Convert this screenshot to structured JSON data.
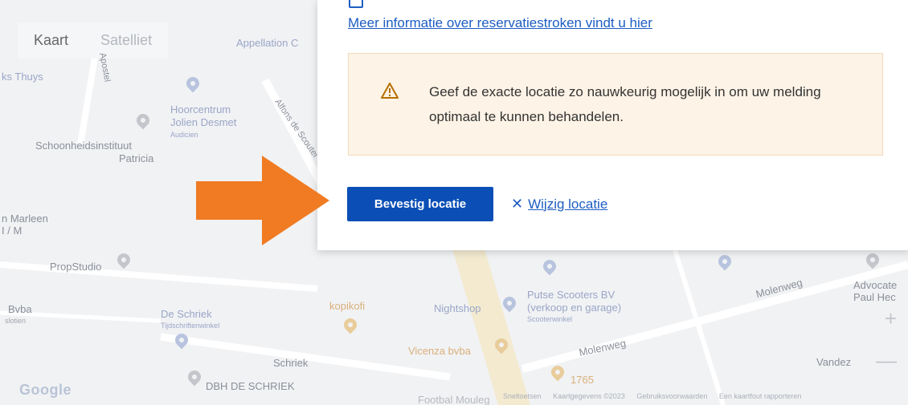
{
  "map": {
    "type_control": {
      "kaart": "Kaart",
      "satelliet": "Satelliet"
    },
    "labels": {
      "appellation": "Appellation C",
      "ks_thuys": "ks Thuys",
      "hoorcentrum_1": "Hoorcentrum",
      "hoorcentrum_2": "Jolien Desmet",
      "audicien": "Audicien",
      "schoonheids_1": "Schoonheidsinstituut",
      "schoonheids_2": "Patricia",
      "street_alfons": "Alfons de Scoutel",
      "street_pol": "Apostel",
      "marleen_1": "n Marleen",
      "marleen_2": "I / M",
      "propstudio": "PropStudio",
      "bvba": "Bvba",
      "bvba_sub": "slotien",
      "schriek_1": "De Schriek",
      "schriek_2": "Tijdschriftenwinkel",
      "kopikofi": "kopikofi",
      "nightshop": "Nightshop",
      "putse_1": "Putse Scooters BV",
      "putse_2": "(verkoop en garage)",
      "putse_3": "Scooterwinkel",
      "vicenza": "Vicenza bvba",
      "molenweg_1": "Molenweg",
      "molenweg_2": "Molenweg",
      "schriek_street": "Schriek",
      "dbh": "DBH DE SCHRIEK",
      "num_1765": "1765",
      "footbal": "Footbal Mouleg",
      "advocate_1": "Advocate",
      "advocate_2": "Paul Hec",
      "vandez": "Vandez"
    },
    "google_logo": "Google",
    "attribution": [
      "Sneltoetsen",
      "Kaartgegevens ©2023",
      "Gebruiksvoorwaarden",
      "Een kaartfout rapporteren"
    ]
  },
  "panel": {
    "info_link": "Meer informatie over reservatiestroken vindt u hier",
    "warning_text": "Geef de exacte locatie zo nauwkeurig mogelijk in om uw melding optimaal te kunnen behandelen.",
    "confirm_label": "Bevestig locatie",
    "change_label": "Wijzig locatie"
  },
  "colors": {
    "primary": "#0b4fb6",
    "link": "#1d5dc2",
    "warning_bg": "#fdf3e6",
    "arrow": "#f07b22"
  }
}
